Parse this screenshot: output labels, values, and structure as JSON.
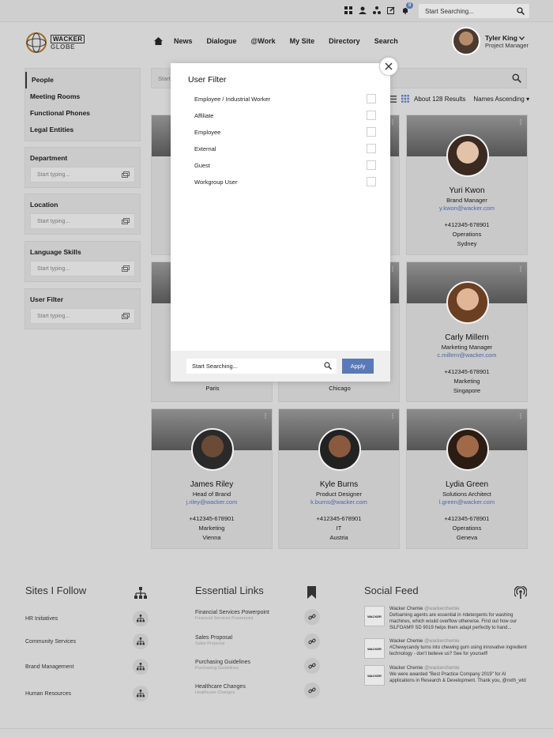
{
  "topbar": {
    "search_placeholder": "Start Searching...",
    "notification_count": "8"
  },
  "brand": {
    "name": "WACKER",
    "sub": "GLOBE"
  },
  "nav": [
    "News",
    "Dialogue",
    "@Work",
    "My Site",
    "Directory",
    "Search"
  ],
  "user": {
    "name": "Tyler King",
    "role": "Project Manager"
  },
  "sidebar": {
    "items": [
      "People",
      "Meeting Rooms",
      "Functional Phones",
      "Legal Entities"
    ],
    "filters": [
      {
        "title": "Department",
        "placeholder": "Start typing..."
      },
      {
        "title": "Location",
        "placeholder": "Start typing..."
      },
      {
        "title": "Language Skills",
        "placeholder": "Start typing..."
      },
      {
        "title": "User Filter",
        "placeholder": "Start typing..."
      }
    ]
  },
  "results": {
    "search_placeholder": "Start",
    "count": "About 128 Results",
    "sort": "Names Ascending"
  },
  "people": [
    {
      "name": "Yuri Kwon",
      "role": "Brand Manager",
      "email": "y.kwon@wacker.com",
      "phone": "+412345-678901",
      "dept": "Operations",
      "city": "Sydney"
    },
    {
      "name": "Carly Millern",
      "role": "Marketing Manager",
      "email": "c.millern@wacker.com",
      "phone": "+412345-678901",
      "dept": "Marketing",
      "city": "Singapore"
    },
    {
      "name": "James Riley",
      "role": "Head of Brand",
      "email": "j.riley@wacker.com",
      "phone": "+412345-678901",
      "dept": "Marketing",
      "city": "Vienna"
    },
    {
      "name": "Kyle Burns",
      "role": "Product Designer",
      "email": "k.burns@wacker.com",
      "phone": "+412345-678901",
      "dept": "IT",
      "city": "Austria"
    },
    {
      "name": "Lydia Green",
      "role": "Solutions Architect",
      "email": "l.green@wacker.com",
      "phone": "+412345-678901",
      "dept": "Operations",
      "city": "Geneva"
    }
  ],
  "partial_cities": [
    "Paris",
    "Chicago"
  ],
  "footer": {
    "sites_title": "Sites I Follow",
    "sites": [
      "HR Initiatives",
      "Community Services",
      "Brand Management",
      "Human Resources"
    ],
    "links_title": "Essential Links",
    "links": [
      {
        "title": "Financial Services Powerpoint",
        "sub": "Financial Services Powerpoint"
      },
      {
        "title": "Sales Proposal",
        "sub": "Sales Proposal"
      },
      {
        "title": "Purchasing Guidelines",
        "sub": "Purchasing Guidelines"
      },
      {
        "title": "Healthcare Changes",
        "sub": "Healthcare Changes"
      }
    ],
    "feed_title": "Social Feed",
    "feed": [
      {
        "author": "Wacker Chemie",
        "handle": "@wackerchemie",
        "text": "Defoaming agents are essential in #detergents for washing machines, which would overflow otherwise. Find out how our SILFOAM® SD 9019 helps them adapt perfectly to hand..."
      },
      {
        "author": "Wacker Chemie",
        "handle": "@wackerchemie",
        "text": "#Chewycandy turns into chewing gum using innovative ingredient technology - don't believe us? See for yourself!"
      },
      {
        "author": "Wacker Chemie",
        "handle": "@wackerchemie",
        "text": "We were awarded \"Best Practice Company 2019\" for AI applications in Research & Development. Thank you, @nxth_wtd"
      }
    ]
  },
  "modal": {
    "title": "User Filter",
    "options": [
      "Employee / Industrial Worker",
      "Affiliate",
      "Employee",
      "External",
      "Guest",
      "Workgroup User"
    ],
    "search_placeholder": "Start Searching...",
    "apply_label": "Apply"
  },
  "colors": {
    "accent": "#5a79b8",
    "email": "#4a66a8",
    "backdrop": "#d3d3d3"
  }
}
